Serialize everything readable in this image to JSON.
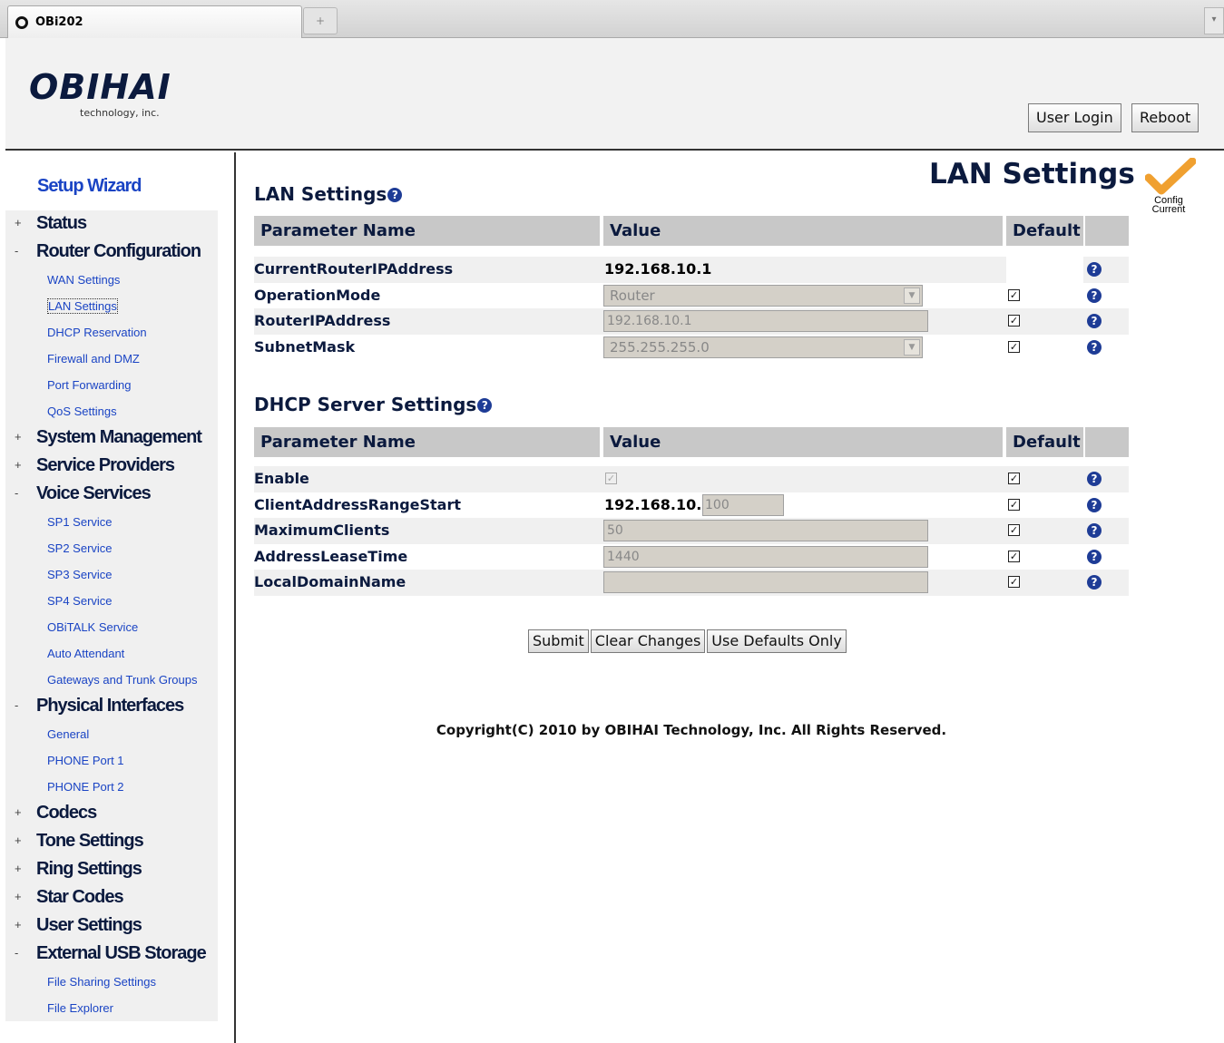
{
  "browser": {
    "tab_title": "OBi202",
    "newtab_glyph": "+",
    "tabmenu_glyph": "▾"
  },
  "header": {
    "logo": "OBIHAI",
    "logo_sub": "technology, inc.",
    "user_login": "User Login",
    "reboot": "Reboot"
  },
  "sidebar": {
    "setup_wizard": "Setup Wizard",
    "categories": [
      {
        "label": "Status",
        "sign": "+"
      },
      {
        "label": "Router Configuration",
        "sign": "-",
        "items": [
          "WAN Settings",
          "LAN Settings",
          "DHCP Reservation",
          "Firewall and DMZ",
          "Port Forwarding",
          "QoS Settings"
        ]
      },
      {
        "label": "System Management",
        "sign": "+"
      },
      {
        "label": "Service Providers",
        "sign": "+"
      },
      {
        "label": "Voice Services",
        "sign": "-",
        "items": [
          "SP1 Service",
          "SP2 Service",
          "SP3 Service",
          "SP4 Service",
          "OBiTALK Service",
          "Auto Attendant",
          "Gateways and Trunk Groups"
        ]
      },
      {
        "label": "Physical Interfaces",
        "sign": "-",
        "items": [
          "General",
          "PHONE Port 1",
          "PHONE Port 2"
        ]
      },
      {
        "label": "Codecs",
        "sign": "+"
      },
      {
        "label": "Tone Settings",
        "sign": "+"
      },
      {
        "label": "Ring Settings",
        "sign": "+"
      },
      {
        "label": "Star Codes",
        "sign": "+"
      },
      {
        "label": "User Settings",
        "sign": "+"
      },
      {
        "label": "External USB Storage",
        "sign": "-",
        "items": [
          "File Sharing Settings",
          "File Explorer"
        ]
      }
    ]
  },
  "main": {
    "page_title": "LAN Settings",
    "config_status_line1": "Config",
    "config_status_line2": "Current",
    "help_glyph": "?",
    "checkmark_glyph": "✓",
    "dropdown_glyph": "▼",
    "columns": {
      "param": "Parameter Name",
      "value": "Value",
      "default": "Default"
    },
    "lan": {
      "title": "LAN Settings",
      "rows": [
        {
          "name": "CurrentRouterIPAddress",
          "value": "192.168.10.1"
        },
        {
          "name": "OperationMode",
          "value": "Router",
          "default_checked": true
        },
        {
          "name": "RouterIPAddress",
          "value": "192.168.10.1",
          "default_checked": true
        },
        {
          "name": "SubnetMask",
          "value": "255.255.255.0",
          "default_checked": true
        }
      ]
    },
    "dhcp": {
      "title": "DHCP Server Settings",
      "rows": [
        {
          "name": "Enable",
          "value_checked": true,
          "default_checked": true
        },
        {
          "name": "ClientAddressRangeStart",
          "prefix": "192.168.10.",
          "value": "100",
          "default_checked": true
        },
        {
          "name": "MaximumClients",
          "value": "50",
          "default_checked": true
        },
        {
          "name": "AddressLeaseTime",
          "value": "1440",
          "default_checked": true
        },
        {
          "name": "LocalDomainName",
          "value": "",
          "default_checked": true
        }
      ]
    },
    "actions": {
      "submit": "Submit",
      "clear": "Clear Changes",
      "defaults": "Use Defaults Only"
    },
    "copyright": "Copyright(C) 2010 by OBIHAI Technology, Inc. All Rights Reserved."
  },
  "colors": {
    "navy": "#0b1a3e",
    "link_blue": "#1a44c4",
    "help_blue": "#1e3c96",
    "header_bg": "#c8c8c8",
    "config_check": "#f0a030"
  }
}
